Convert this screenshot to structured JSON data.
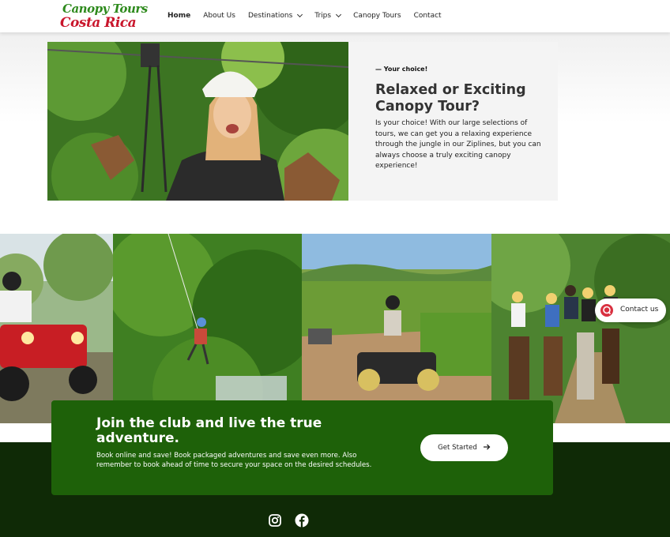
{
  "header": {
    "logo_line1": "Canopy Tours",
    "logo_line2": "Costa Rica",
    "nav": [
      {
        "label": "Home",
        "active": true
      },
      {
        "label": "About Us"
      },
      {
        "label": "Destinations",
        "dropdown": true
      },
      {
        "label": "Trips",
        "dropdown": true
      },
      {
        "label": "Canopy Tours"
      },
      {
        "label": "Contact"
      }
    ]
  },
  "hero": {
    "eyebrow": "— Your choice!",
    "title": "Relaxed or Exciting Canopy Tour?",
    "text": "Is your choice! With our large selections of tours, we can get you a relaxing experience through the jungle in our Ziplines, but you can always choose a truly exciting canopy experience!"
  },
  "gallery": [
    {
      "icon": "atv-rider-photo"
    },
    {
      "icon": "rappelling-waterfall-photo"
    },
    {
      "icon": "atv-hills-photo"
    },
    {
      "icon": "horseback-riding-photo"
    }
  ],
  "contact_widget": {
    "label": "Contact us",
    "icon": "chat-icon"
  },
  "cta": {
    "title": "Join the club and live the true adventure.",
    "text": "Book online and save! Book packaged adventures and save even more. Also remember to book ahead of time to secure your space on the desired schedules.",
    "button_label": "Get Started",
    "button_icon": "arrow-right-icon"
  },
  "footer": {
    "social": [
      {
        "icon": "instagram-icon"
      },
      {
        "icon": "facebook-icon"
      }
    ]
  },
  "colors": {
    "logo_green": "#2e8a1d",
    "logo_red": "#c9162c",
    "cta_green": "#1e6109",
    "footer_dark": "#0f2a06"
  }
}
